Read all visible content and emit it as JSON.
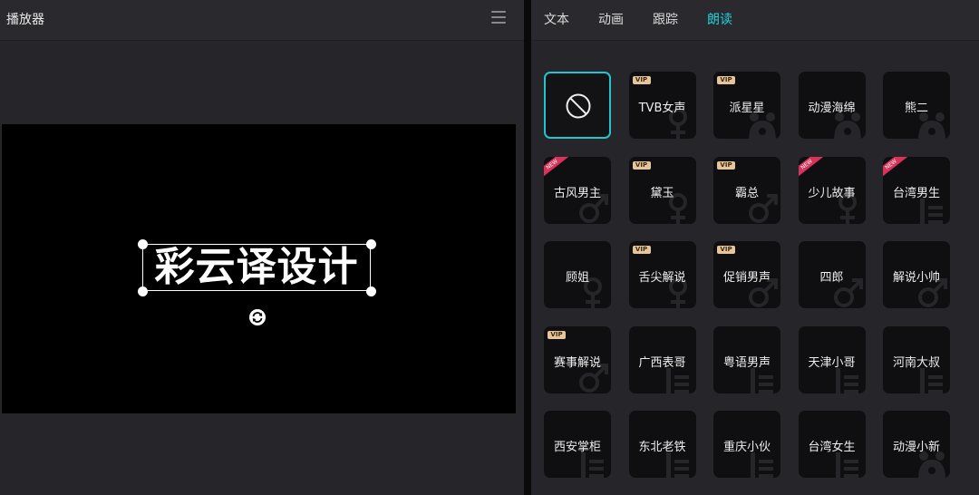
{
  "player": {
    "title": "播放器",
    "canvas_text": "彩云译设计"
  },
  "tabs": [
    "文本",
    "动画",
    "跟踪",
    "朗读"
  ],
  "active_tab": "朗读",
  "accent_color": "#1fd2dc",
  "voices": [
    {
      "label": "",
      "icon": "none-icon",
      "badge": "",
      "deco": "",
      "selected": true
    },
    {
      "label": "TVB女声",
      "badge": "VIP",
      "deco": "female"
    },
    {
      "label": "派星星",
      "badge": "VIP",
      "deco": "cartoon"
    },
    {
      "label": "动漫海绵",
      "badge": "",
      "deco": "cartoon"
    },
    {
      "label": "熊二",
      "badge": "",
      "deco": "cartoon"
    },
    {
      "label": "古风男主",
      "badge": "NEW",
      "deco": "male"
    },
    {
      "label": "黛玉",
      "badge": "VIP",
      "deco": "female"
    },
    {
      "label": "霸总",
      "badge": "VIP",
      "deco": "male"
    },
    {
      "label": "少儿故事",
      "badge": "NEW",
      "deco": "female"
    },
    {
      "label": "台湾男生",
      "badge": "NEW",
      "deco": "dialect"
    },
    {
      "label": "顾姐",
      "badge": "",
      "deco": "female"
    },
    {
      "label": "舌尖解说",
      "badge": "VIP",
      "deco": "female"
    },
    {
      "label": "促销男声",
      "badge": "VIP",
      "deco": "male"
    },
    {
      "label": "四郎",
      "badge": "",
      "deco": "male"
    },
    {
      "label": "解说小帅",
      "badge": "",
      "deco": "male"
    },
    {
      "label": "赛事解说",
      "badge": "VIP",
      "deco": "male"
    },
    {
      "label": "广西表哥",
      "badge": "",
      "deco": "dialect"
    },
    {
      "label": "粤语男声",
      "badge": "",
      "deco": "dialect"
    },
    {
      "label": "天津小哥",
      "badge": "",
      "deco": "dialect"
    },
    {
      "label": "河南大叔",
      "badge": "",
      "deco": "dialect"
    },
    {
      "label": "西安掌柜",
      "badge": "",
      "deco": "dialect"
    },
    {
      "label": "东北老铁",
      "badge": "",
      "deco": "dialect"
    },
    {
      "label": "重庆小伙",
      "badge": "",
      "deco": "dialect"
    },
    {
      "label": "台湾女生",
      "badge": "",
      "deco": "dialect"
    },
    {
      "label": "动漫小新",
      "badge": "",
      "deco": "cartoon"
    }
  ]
}
